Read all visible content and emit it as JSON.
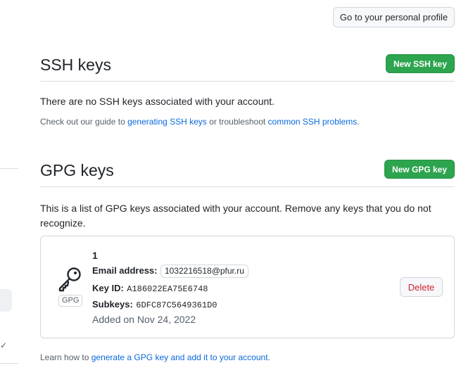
{
  "header": {
    "profile_button": "Go to your personal profile"
  },
  "ssh": {
    "title": "SSH keys",
    "new_button": "New SSH key",
    "empty_text": "There are no SSH keys associated with your account.",
    "guide_prefix": "Check out our guide to ",
    "guide_link1": "generating SSH keys",
    "guide_middle": " or troubleshoot ",
    "guide_link2": "common SSH problems",
    "guide_suffix": "."
  },
  "gpg": {
    "title": "GPG keys",
    "new_button": "New GPG key",
    "description": "This is a list of GPG keys associated with your account. Remove any keys that you do not recognize.",
    "key": {
      "name": "1",
      "badge": "GPG",
      "email_label": "Email address:",
      "email": "1032216518@pfur.ru",
      "key_id_label": "Key ID:",
      "key_id": "A186022EA75E6748",
      "subkeys_label": "Subkeys:",
      "subkeys": "6DFC87C5649361D0",
      "added": "Added on Nov 24, 2022",
      "delete_button": "Delete"
    },
    "learn_prefix": "Learn how to ",
    "learn_link": "generate a GPG key and add it to your account",
    "learn_suffix": "."
  },
  "sidebar": {
    "check_glyph": "✓"
  }
}
